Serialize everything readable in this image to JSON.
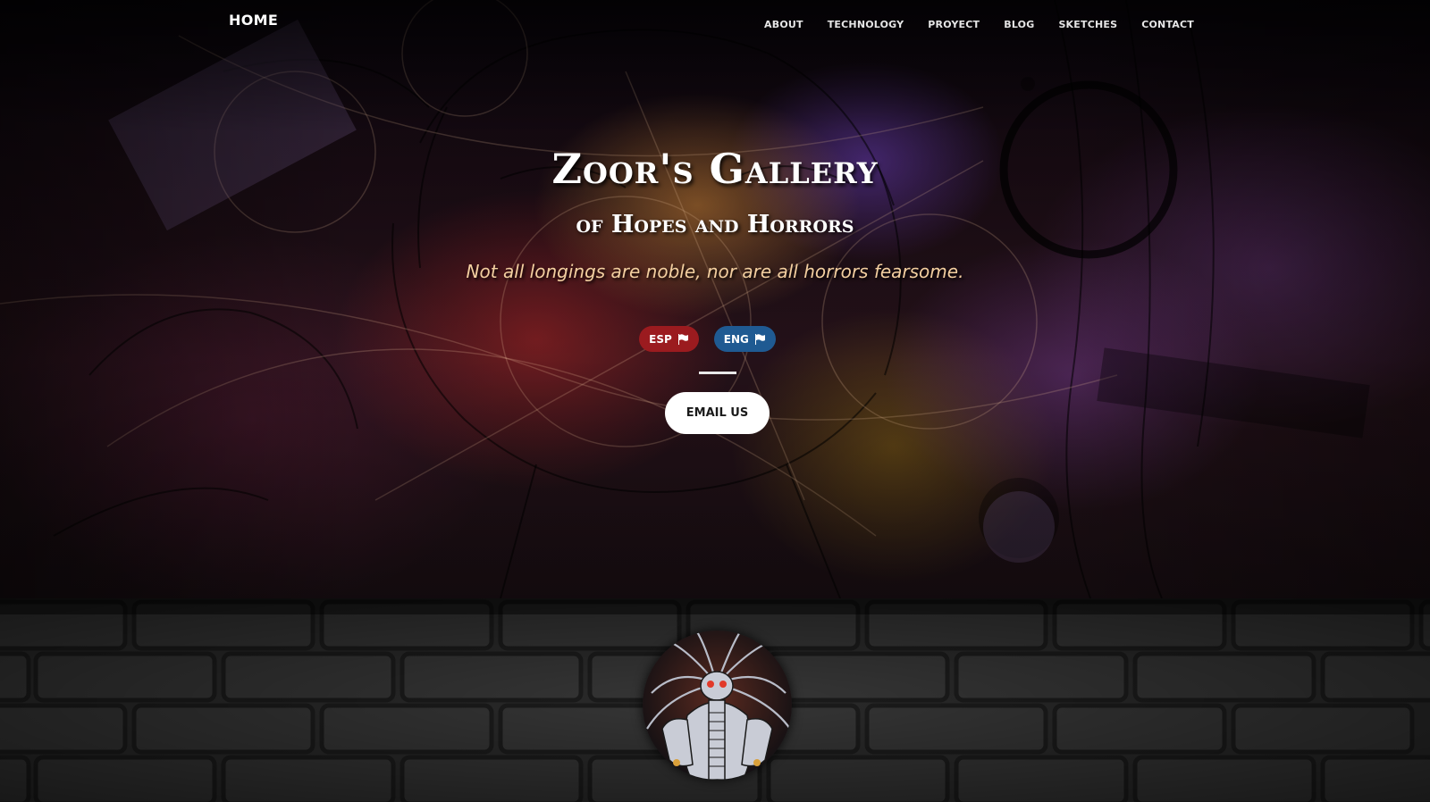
{
  "nav": {
    "brand": "HOME",
    "links": [
      {
        "label": "ABOUT"
      },
      {
        "label": "TECHNOLOGY"
      },
      {
        "label": "PROYECT"
      },
      {
        "label": "BLOG"
      },
      {
        "label": "SKETCHES"
      },
      {
        "label": "CONTACT"
      }
    ]
  },
  "hero": {
    "title": "Zoor's Gallery",
    "subtitle": "of Hopes and Horrors",
    "tagline": "Not all longings are noble, nor are all horrors fearsome.",
    "languages": [
      {
        "label": "ESP",
        "icon": "flag-icon",
        "color": "#9b1b1f"
      },
      {
        "label": "ENG",
        "icon": "flag-icon",
        "color": "#1f5a92"
      }
    ],
    "email_button": "EMAIL US"
  },
  "colors": {
    "tagline": "#f3cfa0",
    "esp": "#9b1b1f",
    "eng": "#1f5a92",
    "email_bg": "#ffffff"
  },
  "lower": {
    "avatar_icon": "robot-creature-portrait"
  }
}
